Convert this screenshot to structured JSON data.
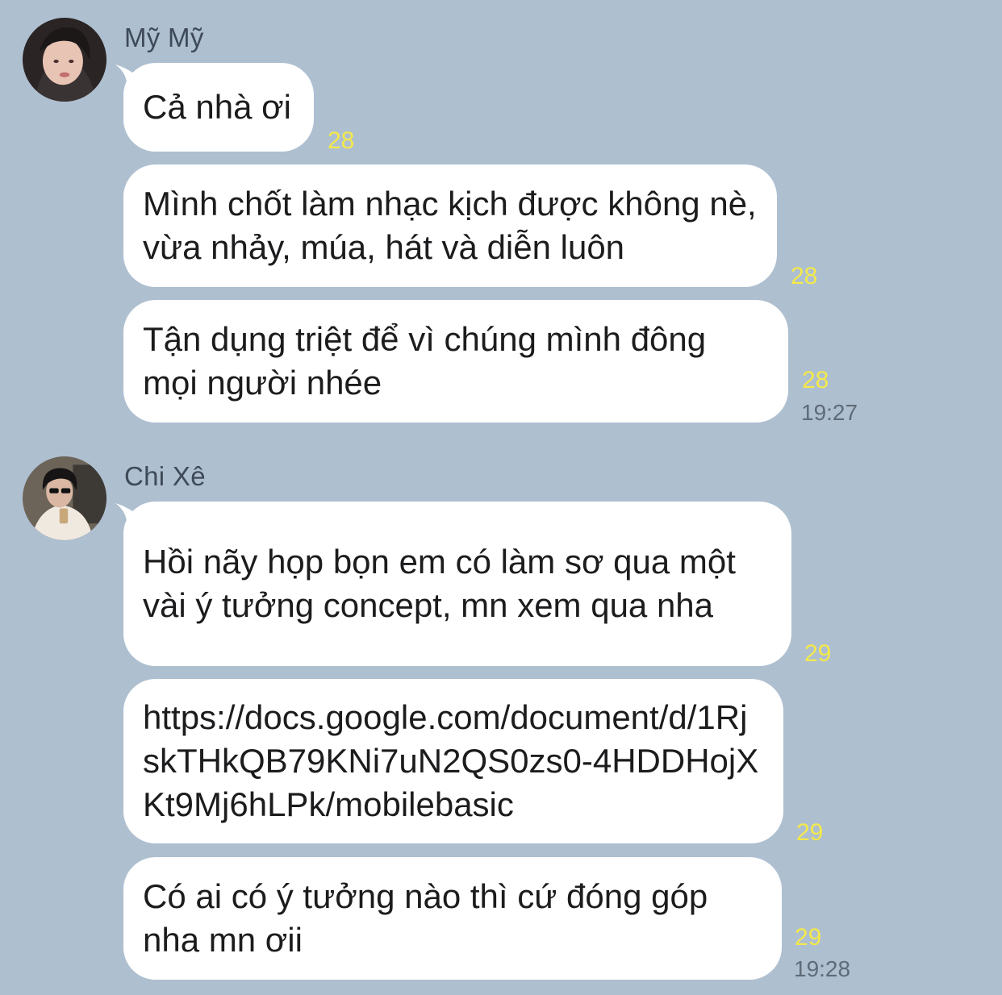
{
  "chat": {
    "groups": [
      {
        "sender": "Mỹ Mỹ",
        "avatar_icon": "user-avatar",
        "messages": [
          {
            "text": "Cả nhà ơi",
            "read": "28"
          },
          {
            "text": "Mình chốt làm nhạc kịch được không nè, vừa nhảy, múa, hát và diễn luôn",
            "read": "28"
          },
          {
            "text": "Tận dụng triệt để vì chúng mình đông mọi người nhée",
            "read": "28",
            "time": "19:27"
          }
        ]
      },
      {
        "sender": "Chi Xê",
        "avatar_icon": "user-avatar",
        "messages": [
          {
            "text": "Hồi nãy họp bọn em có làm sơ qua một vài ý tưởng concept, mn xem qua nha",
            "read": "29"
          },
          {
            "text": "https://docs.google.com/document/d/1RjskTHkQB79KNi7uN2QS0zs0-4HDDHojXKt9Mj6hLPk/mobilebasic",
            "read": "29"
          },
          {
            "text": "Có ai có ý tưởng nào thì cứ đóng góp nha mn ơii",
            "read": "29",
            "time": "19:28"
          }
        ]
      }
    ],
    "colors": {
      "background": "#aebfd0",
      "bubble": "#ffffff",
      "read_count": "#f4e94a"
    }
  }
}
